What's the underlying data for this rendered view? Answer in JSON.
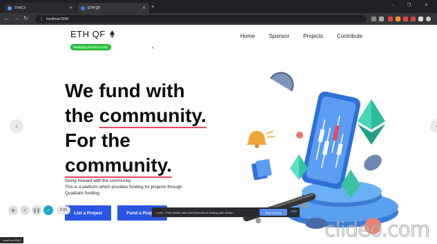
{
  "browser": {
    "tabs": [
      {
        "label": "THACF"
      },
      {
        "label": "ETH QF"
      }
    ],
    "new_tab": "+",
    "url": "localhost:3000",
    "window_controls": "– ❐ ✕"
  },
  "site": {
    "logo": "ETH QF",
    "live_badge": "Watching Round is LIVE",
    "nav": [
      "Home",
      "Sponsor",
      "Projects",
      "Contribute"
    ],
    "headline": {
      "l1": "We fund with",
      "l2a": "the ",
      "l2b": "community.",
      "l3": "For the",
      "l4": "community."
    },
    "subtext": [
      "Going forward with the community.",
      "This is a platform which provides funding for projects through",
      "Quadratic funding."
    ],
    "buttons": {
      "list": "List a Project",
      "fund": "Fund a Project"
    }
  },
  "overlays": {
    "share_text": "Loom – Free Screen and Cam Recorder is sharing your screen.",
    "stop_sharing": "Stop sharing",
    "hide": "Hide",
    "timer": "5:20",
    "status_url": "localhost:3000",
    "watermark": "clideo.com"
  },
  "colors": {
    "accent": "#2b56e3",
    "underline": "#e8475c",
    "live": "#2ecc40"
  }
}
